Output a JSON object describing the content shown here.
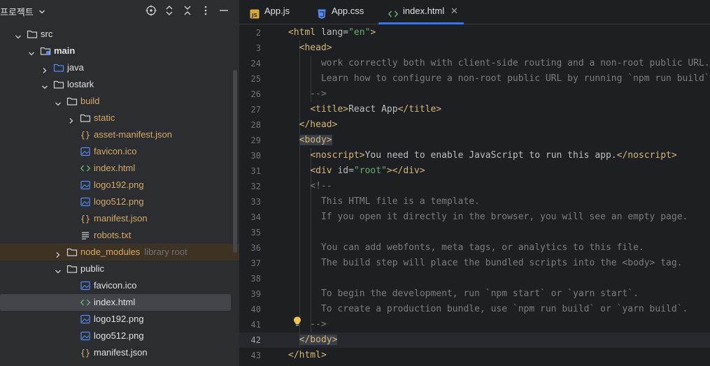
{
  "project_panel": {
    "title": "프로젝트",
    "tree": [
      {
        "label": "src",
        "note": "",
        "kind": "folder",
        "style": "normal"
      },
      {
        "label": "main",
        "note": "",
        "kind": "module-folder",
        "style": "bold"
      },
      {
        "label": "java",
        "note": "",
        "kind": "source-folder",
        "style": "normal"
      },
      {
        "label": "lostark",
        "note": "",
        "kind": "folder",
        "style": "normal"
      },
      {
        "label": "build",
        "note": "",
        "kind": "folder",
        "style": "orange"
      },
      {
        "label": "static",
        "note": "",
        "kind": "folder",
        "style": "orange"
      },
      {
        "label": "asset-manifest.json",
        "note": "",
        "kind": "json-file",
        "style": "orange"
      },
      {
        "label": "favicon.ico",
        "note": "",
        "kind": "image-file",
        "style": "orange"
      },
      {
        "label": "index.html",
        "note": "",
        "kind": "html-file",
        "style": "orange"
      },
      {
        "label": "logo192.png",
        "note": "",
        "kind": "image-file",
        "style": "orange"
      },
      {
        "label": "logo512.png",
        "note": "",
        "kind": "image-file",
        "style": "orange"
      },
      {
        "label": "manifest.json",
        "note": "",
        "kind": "json-file",
        "style": "orange"
      },
      {
        "label": "robots.txt",
        "note": "",
        "kind": "text-file",
        "style": "orange"
      },
      {
        "label": "node_modules",
        "note": "library root",
        "kind": "folder",
        "style": "orange"
      },
      {
        "label": "public",
        "note": "",
        "kind": "folder",
        "style": "normal"
      },
      {
        "label": "favicon.ico",
        "note": "",
        "kind": "image-file",
        "style": "normal"
      },
      {
        "label": "index.html",
        "note": "",
        "kind": "html-file",
        "style": "normal"
      },
      {
        "label": "logo192.png",
        "note": "",
        "kind": "image-file",
        "style": "normal"
      },
      {
        "label": "logo512.png",
        "note": "",
        "kind": "image-file",
        "style": "normal"
      },
      {
        "label": "manifest.json",
        "note": "",
        "kind": "json-file",
        "style": "normal"
      }
    ],
    "header_icons": [
      "locate-icon",
      "expand-all-icon",
      "collapse-all-icon",
      "more-options-icon",
      "hide-icon"
    ]
  },
  "editor": {
    "tabs": [
      {
        "label": "App.js",
        "icon": "js-file-icon",
        "active": false
      },
      {
        "label": "App.css",
        "icon": "css-file-icon",
        "active": false
      },
      {
        "label": "index.html",
        "icon": "html-file-icon",
        "active": true
      }
    ],
    "line_numbers": [
      "2",
      "3",
      "24",
      "25",
      "26",
      "27",
      "28",
      "29",
      "30",
      "31",
      "32",
      "33",
      "34",
      "35",
      "36",
      "37",
      "38",
      "39",
      "40",
      "41",
      "42",
      "43"
    ],
    "current_line": "42",
    "lines": [
      "<html lang=\"en\">",
      "  <head>",
      "      work correctly both with client-side routing and a non-root public URL.",
      "      Learn how to configure a non-root public URL by running `npm run build`.",
      "    -->",
      "    <title>React App</title>",
      "  </head>",
      "  <body>",
      "    <noscript>You need to enable JavaScript to run this app.</noscript>",
      "    <div id=\"root\"></div>",
      "    <!--",
      "      This HTML file is a template.",
      "      If you open it directly in the browser, you will see an empty page.",
      "",
      "      You can add webfonts, meta tags, or analytics to this file.",
      "      The build step will place the bundled scripts into the <body> tag.",
      "",
      "      To begin the development, run `npm start` or `yarn start`.",
      "      To create a production bundle, use `npm run build` or `yarn build`.",
      "    -->",
      "  </body>",
      "</html>"
    ]
  },
  "colors": {
    "panel_bg": "#2b2d30",
    "editor_bg": "#1e1f22",
    "accent": "#3574f0",
    "tag": "#d5b778",
    "string": "#6aab73",
    "comment": "#7a7e85",
    "excluded_folder": "#d6a96b"
  }
}
